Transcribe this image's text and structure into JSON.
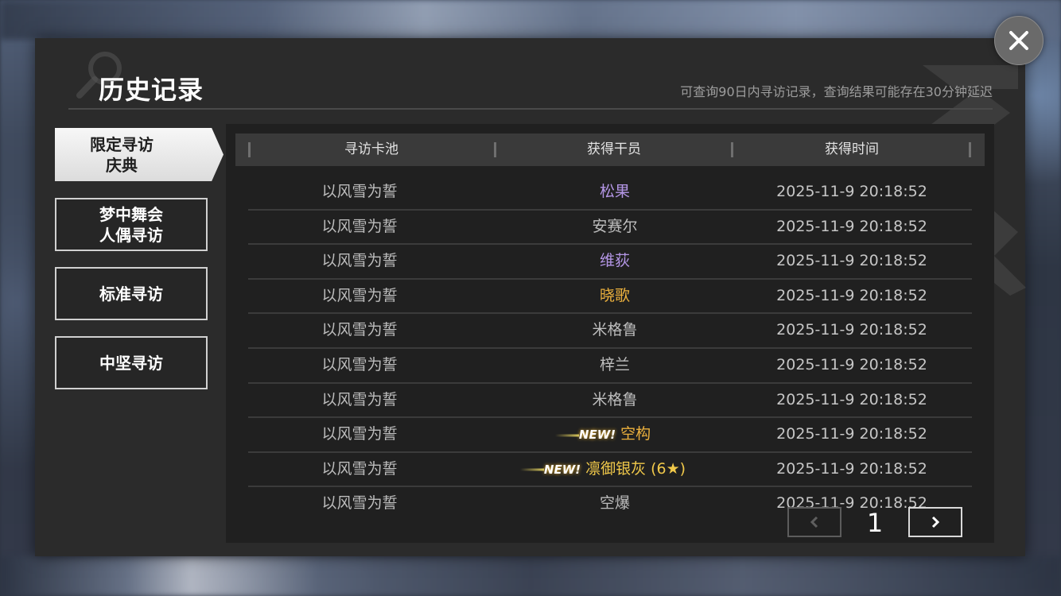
{
  "header": {
    "title": "历史记录",
    "notice": "可查询90日内寻访记录，查询结果可能存在30分钟延迟"
  },
  "tabs": [
    {
      "label_line1": "限定寻访",
      "label_line2": "庆典",
      "active": true
    },
    {
      "label_line1": "梦中舞会",
      "label_line2": "人偶寻访",
      "active": false
    },
    {
      "label": "标准寻访",
      "active": false
    },
    {
      "label": "中坚寻访",
      "active": false
    }
  ],
  "table": {
    "columns": [
      "寻访卡池",
      "获得干员",
      "获得时间"
    ],
    "rows": [
      {
        "pool": "以风雪为誓",
        "operator": "松果",
        "time": "2025-11-9 20:18:52",
        "rarity_color": "#b496e6",
        "is_new": false
      },
      {
        "pool": "以风雪为誓",
        "operator": "安赛尔",
        "time": "2025-11-9 20:18:52",
        "rarity_color": "#bdbdbd",
        "is_new": false
      },
      {
        "pool": "以风雪为誓",
        "operator": "维荻",
        "time": "2025-11-9 20:18:52",
        "rarity_color": "#b496e6",
        "is_new": false
      },
      {
        "pool": "以风雪为誓",
        "operator": "晓歌",
        "time": "2025-11-9 20:18:52",
        "rarity_color": "#ebb03d",
        "is_new": false
      },
      {
        "pool": "以风雪为誓",
        "operator": "米格鲁",
        "time": "2025-11-9 20:18:52",
        "rarity_color": "#bdbdbd",
        "is_new": false
      },
      {
        "pool": "以风雪为誓",
        "operator": "梓兰",
        "time": "2025-11-9 20:18:52",
        "rarity_color": "#bdbdbd",
        "is_new": false
      },
      {
        "pool": "以风雪为誓",
        "operator": "米格鲁",
        "time": "2025-11-9 20:18:52",
        "rarity_color": "#bdbdbd",
        "is_new": false
      },
      {
        "pool": "以风雪为誓",
        "operator": "空构",
        "time": "2025-11-9 20:18:52",
        "rarity_color": "#ebb03d",
        "is_new": true,
        "new_label": "NEW!"
      },
      {
        "pool": "以风雪为誓",
        "operator": "凛御银灰 (6★)",
        "time": "2025-11-9 20:18:52",
        "rarity_color": "#f1c94a",
        "is_new": true,
        "new_label": "NEW!"
      },
      {
        "pool": "以风雪为誓",
        "operator": "空爆",
        "time": "2025-11-9 20:18:52",
        "rarity_color": "#bdbdbd",
        "is_new": false
      }
    ]
  },
  "pagination": {
    "current_page": "1"
  },
  "icons": {
    "close": "close-icon",
    "prev": "chevron-left-icon",
    "next": "chevron-right-icon",
    "decor": "magnifier-icon"
  }
}
